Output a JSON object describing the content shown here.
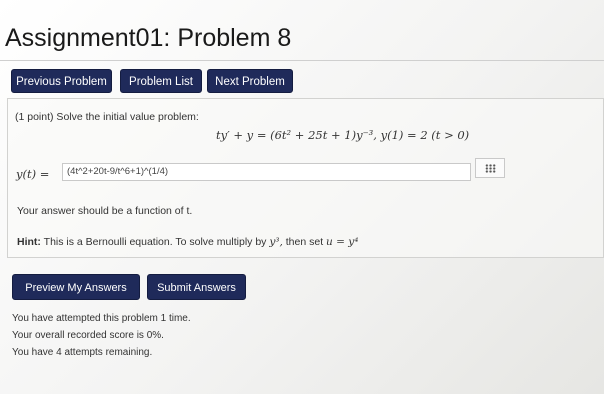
{
  "page": {
    "title": "Assignment01: Problem 8"
  },
  "nav": {
    "previous_label": "Previous Problem",
    "list_label": "Problem List",
    "next_label": "Next Problem"
  },
  "problem": {
    "intro": "(1 point) Solve the initial value problem:",
    "equation_text": "ty′ + y = (6t² + 25t + 1)y⁻³,   y(1) = 2   (t > 0)",
    "answer_label": "y(t) =",
    "answer_value": "(4t^2+20t-9/t^6+1)^(1/4)",
    "function_note": "Your answer should be a function of t.",
    "hint_prefix": "Hint:",
    "hint_text": "This is a Bernoulli equation. To solve multiply by",
    "hint_multiply": "y³,",
    "hint_then": "then set",
    "hint_sub": "u = y⁴"
  },
  "actions": {
    "preview_label": "Preview My Answers",
    "submit_label": "Submit Answers"
  },
  "status": {
    "attempted": "You have attempted this problem 1 time.",
    "score": "Your overall recorded score is 0%.",
    "remaining": "You have 4 attempts remaining."
  },
  "icons": {
    "input_helper": "grid-dots-icon"
  },
  "colors": {
    "button_bg": "#1f2a5a",
    "button_text": "#ffffff"
  }
}
